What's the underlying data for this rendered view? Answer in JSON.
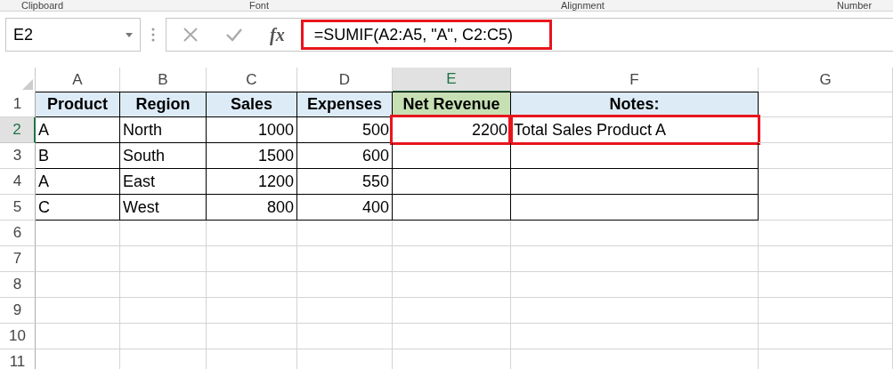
{
  "ribbon_groups": [
    "Clipboard",
    "Font",
    "Alignment",
    "Number"
  ],
  "name_box": "E2",
  "formula_bar": {
    "function_label": "fx",
    "text": "=SUMIF(A2:A5, \"A\", C2:C5)",
    "highlighted": true
  },
  "columns": [
    {
      "label": "A",
      "selected": false
    },
    {
      "label": "B",
      "selected": false
    },
    {
      "label": "C",
      "selected": false
    },
    {
      "label": "D",
      "selected": false
    },
    {
      "label": "E",
      "selected": true
    },
    {
      "label": "F",
      "selected": false
    },
    {
      "label": "G",
      "selected": false
    }
  ],
  "rows": [
    {
      "label": "1",
      "selected": false,
      "cells": [
        {
          "kind": "header",
          "text": "Product",
          "color": "#ddebf7"
        },
        {
          "kind": "header",
          "text": "Region",
          "color": "#ddebf7"
        },
        {
          "kind": "header",
          "text": "Sales",
          "color": "#ddebf7"
        },
        {
          "kind": "header",
          "text": "Expenses",
          "color": "#ddebf7"
        },
        {
          "kind": "header",
          "text": "Net Revenue",
          "color": "#c6e0b4"
        },
        {
          "kind": "header",
          "text": "Notes:",
          "color": "#ddebf7"
        }
      ]
    },
    {
      "label": "2",
      "selected": true,
      "cells": [
        {
          "kind": "text",
          "text": "A"
        },
        {
          "kind": "text",
          "text": "North"
        },
        {
          "kind": "number",
          "text": "1000"
        },
        {
          "kind": "number",
          "text": "500"
        },
        {
          "kind": "number",
          "text": "2200",
          "highlighted": true
        },
        {
          "kind": "text",
          "text": "Total Sales Product A",
          "highlighted": true
        }
      ]
    },
    {
      "label": "3",
      "selected": false,
      "cells": [
        {
          "kind": "text",
          "text": "B"
        },
        {
          "kind": "text",
          "text": "South"
        },
        {
          "kind": "number",
          "text": "1500"
        },
        {
          "kind": "number",
          "text": "600"
        },
        {
          "kind": "empty"
        },
        {
          "kind": "empty"
        }
      ]
    },
    {
      "label": "4",
      "selected": false,
      "cells": [
        {
          "kind": "text",
          "text": "A"
        },
        {
          "kind": "text",
          "text": "East"
        },
        {
          "kind": "number",
          "text": "1200"
        },
        {
          "kind": "number",
          "text": "550"
        },
        {
          "kind": "empty"
        },
        {
          "kind": "empty"
        }
      ]
    },
    {
      "label": "5",
      "selected": false,
      "cells": [
        {
          "kind": "text",
          "text": "C"
        },
        {
          "kind": "text",
          "text": "West"
        },
        {
          "kind": "number",
          "text": "800"
        },
        {
          "kind": "number",
          "text": "400"
        },
        {
          "kind": "empty"
        },
        {
          "kind": "empty"
        }
      ]
    },
    {
      "label": "6",
      "selected": false,
      "cells": []
    },
    {
      "label": "7",
      "selected": false,
      "cells": []
    },
    {
      "label": "8",
      "selected": false,
      "cells": []
    },
    {
      "label": "9",
      "selected": false,
      "cells": []
    },
    {
      "label": "10",
      "selected": false,
      "cells": []
    },
    {
      "label": "11",
      "selected": false,
      "cells": []
    }
  ]
}
